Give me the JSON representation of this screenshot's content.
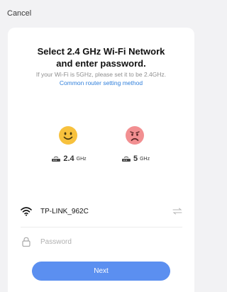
{
  "header": {
    "cancel_label": "Cancel"
  },
  "card": {
    "title_line1": "Select 2.4 GHz Wi-Fi Network",
    "title_line2": "and enter password.",
    "subtitle": "If your Wi-Fi is 5GHz, please set it to be 2.4GHz.",
    "link": "Common router setting method"
  },
  "bands": [
    {
      "freq": "2.4",
      "unit": "GHz",
      "mood": "happy",
      "face_color": "#f7c13d",
      "icon": "router-icon"
    },
    {
      "freq": "5",
      "unit": "GHz",
      "mood": "sad",
      "face_color": "#f28f91",
      "icon": "router-icon"
    }
  ],
  "form": {
    "ssid": "TP-LINK_962C",
    "password_placeholder": "Password",
    "password_value": "",
    "next_label": "Next",
    "accent_color": "#5b8ff0"
  }
}
